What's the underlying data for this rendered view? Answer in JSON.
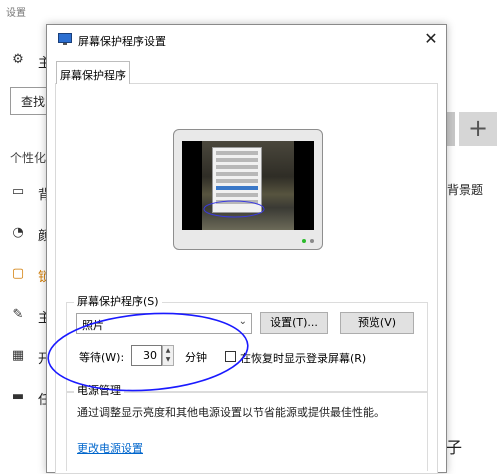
{
  "background_window": {
    "title": "设置",
    "find_label": "查找",
    "section_label": "个性化",
    "items": [
      {
        "icon": "image-icon",
        "text": "背"
      },
      {
        "icon": "palette-icon",
        "text": "颜"
      },
      {
        "icon": "lock-screen-icon",
        "text": "锁"
      },
      {
        "icon": "brush-icon",
        "text": "主"
      },
      {
        "icon": "start-icon",
        "text": "开"
      },
      {
        "icon": "taskbar-icon",
        "text": "任"
      }
    ],
    "home_icon": "gear-icon",
    "home_text": "主",
    "right_text": "背景题",
    "right_plus": "+",
    "bottom_right_text": "子",
    "active_color": "#d07a00"
  },
  "dialog": {
    "title": "屏幕保护程序设置",
    "close_label": "✕",
    "tab_label": "屏幕保护程序",
    "screensaver_group_label": "屏幕保护程序(S)",
    "screensaver_selected": "照片",
    "settings_button": "设置(T)...",
    "preview_button": "预览(V)",
    "wait_label": "等待(W):",
    "wait_value": "30",
    "wait_unit": "分钟",
    "resume_checkbox_label": "在恢复时显示登录屏幕(R)",
    "resume_checked": false,
    "power_group_label": "电源管理",
    "power_description": "通过调整显示亮度和其他电源设置以节省能源或提供最佳性能。",
    "power_link": "更改电源设置"
  },
  "colors": {
    "link": "#0066cc",
    "annotation": "#1a1aff"
  }
}
